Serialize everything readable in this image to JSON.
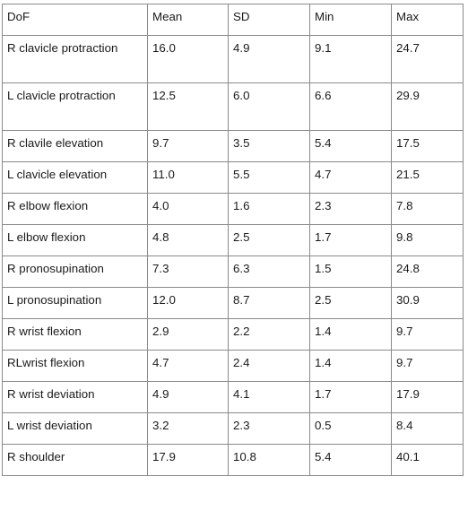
{
  "table": {
    "headers": [
      "DoF",
      "Mean",
      "SD",
      "Min",
      "Max"
    ],
    "rows": [
      [
        "R clavicle protraction",
        "16.0",
        "4.9",
        "9.1",
        "24.7"
      ],
      [
        "L clavicle protraction",
        "12.5",
        "6.0",
        "6.6",
        "29.9"
      ],
      [
        "R clavile elevation",
        "9.7",
        "3.5",
        "5.4",
        "17.5"
      ],
      [
        "L clavicle elevation",
        "11.0",
        "5.5",
        "4.7",
        "21.5"
      ],
      [
        "R elbow flexion",
        "4.0",
        "1.6",
        "2.3",
        "7.8"
      ],
      [
        "L elbow flexion",
        "4.8",
        "2.5",
        "1.7",
        "9.8"
      ],
      [
        "R pronosupination",
        "7.3",
        "6.3",
        "1.5",
        "24.8"
      ],
      [
        "L pronosupination",
        "12.0",
        "8.7",
        "2.5",
        "30.9"
      ],
      [
        "R wrist flexion",
        "2.9",
        "2.2",
        "1.4",
        "9.7"
      ],
      [
        "RLwrist flexion",
        "4.7",
        "2.4",
        "1.4",
        "9.7"
      ],
      [
        "R wrist deviation",
        "4.9",
        "4.1",
        "1.7",
        "17.9"
      ],
      [
        "L wrist deviation",
        "3.2",
        "2.3",
        "0.5",
        "8.4"
      ],
      [
        "R shoulder",
        "17.9",
        "10.8",
        "5.4",
        "40.1"
      ]
    ]
  }
}
